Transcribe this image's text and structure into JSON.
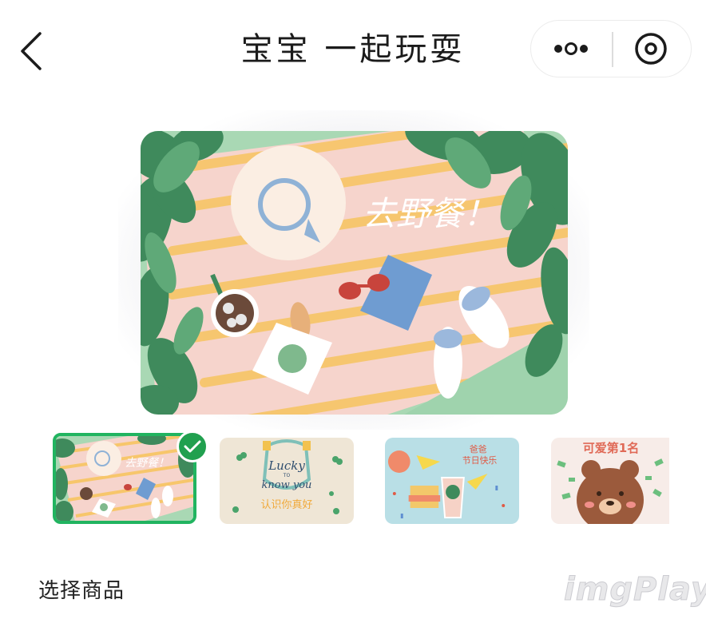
{
  "header": {
    "title": "宝宝 一起玩耍",
    "back_icon": "chevron-left-icon",
    "more_icon": "more-dots-icon",
    "close_icon": "target-circle-icon"
  },
  "main_card": {
    "headline": "去野餐！"
  },
  "thumbnails": [
    {
      "theme": "picnic",
      "text": "去野餐！",
      "selected": true
    },
    {
      "theme": "lucky",
      "text_lines": [
        "Lucky",
        "TO",
        "know you"
      ],
      "caption": "认识你真好",
      "selected": false
    },
    {
      "theme": "holiday",
      "text_lines": [
        "爸爸",
        "节日快乐"
      ],
      "selected": false
    },
    {
      "theme": "bear",
      "text": "可爱第1名",
      "selected": false
    }
  ],
  "section": {
    "title": "选择商品"
  },
  "watermark": "imgPlay",
  "colors": {
    "accent_green": "#21b460",
    "check_green": "#21a04f",
    "leaf_green": "#3f8a5c",
    "blanket_pink": "#f6d4cc",
    "stripe_yellow": "#f7c66b"
  }
}
